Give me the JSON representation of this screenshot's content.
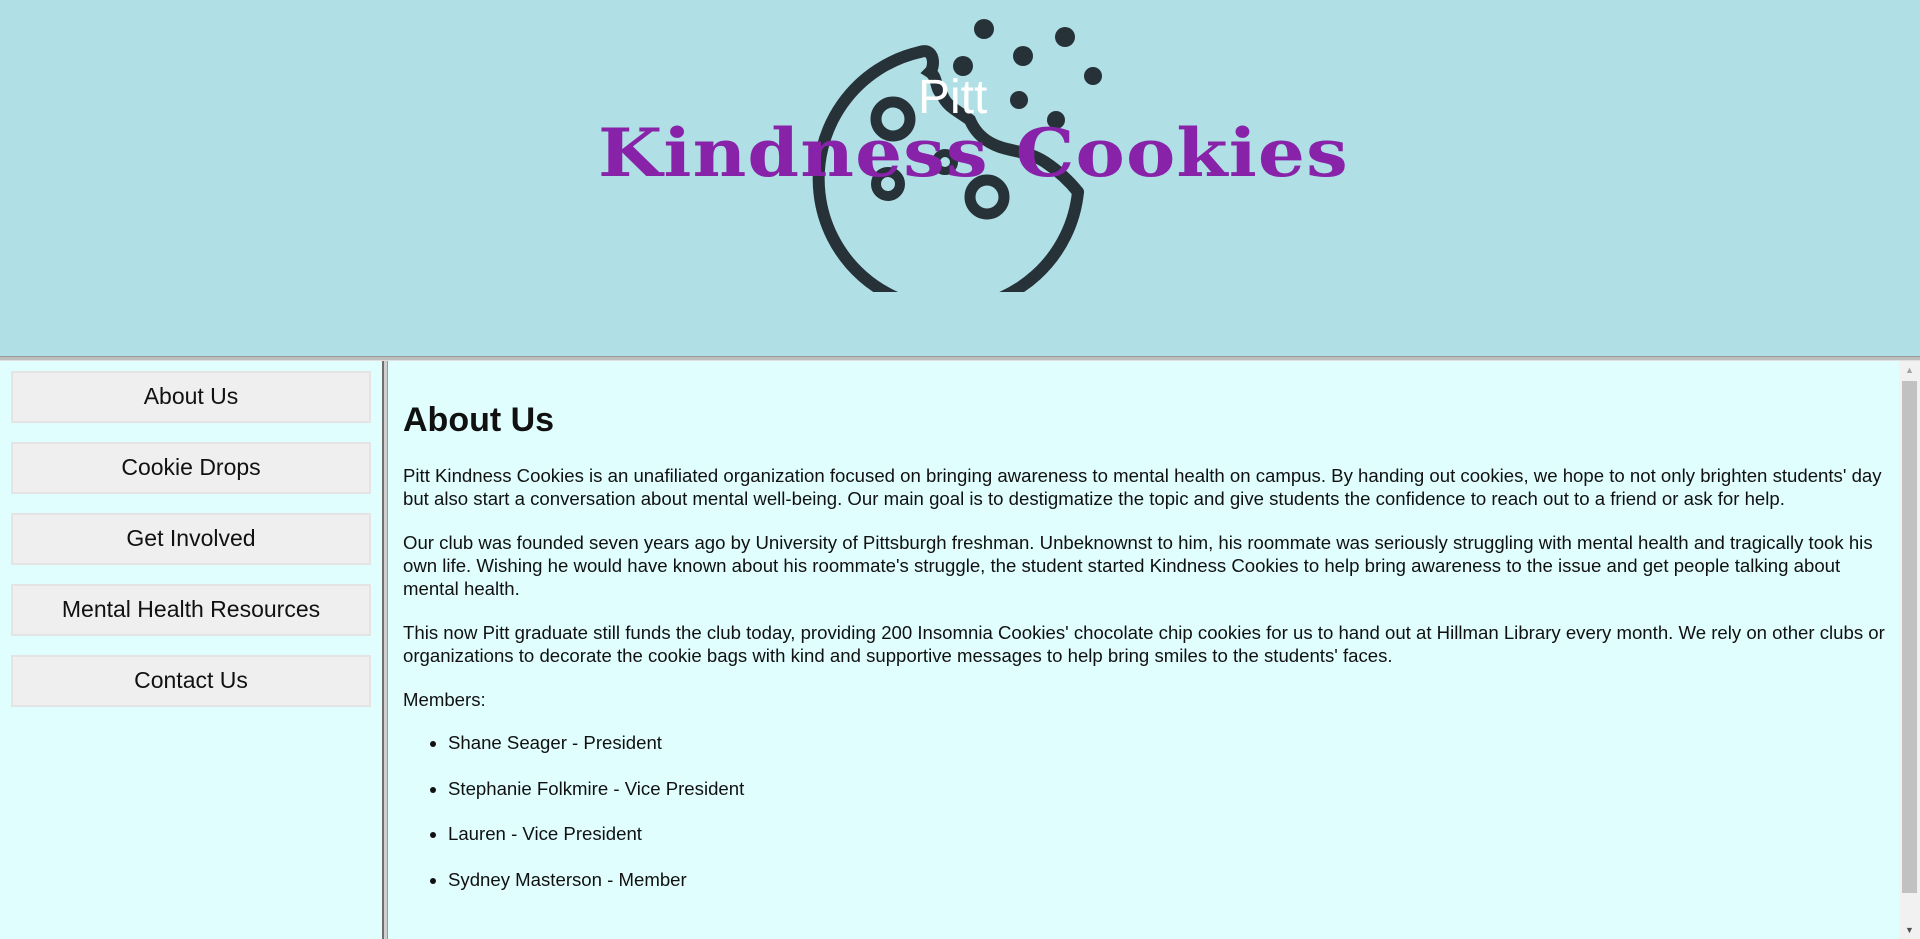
{
  "header": {
    "logo_small": "Pitt",
    "logo_main": "Kindness Cookies"
  },
  "colors": {
    "header_bg": "#b0dfe5",
    "content_bg": "#e0fefe",
    "brand_purple": "#8822a8",
    "cookie_dark": "#263238"
  },
  "sidebar": {
    "items": [
      {
        "label": "About Us"
      },
      {
        "label": "Cookie Drops"
      },
      {
        "label": "Get Involved"
      },
      {
        "label": "Mental Health Resources"
      },
      {
        "label": "Contact Us"
      }
    ]
  },
  "main": {
    "title": "About Us",
    "paragraphs": [
      "Pitt Kindness Cookies is an unafiliated organization focused on bringing awareness to mental health on campus. By handing out cookies, we hope to not only brighten students' day but also start a conversation about mental well-being. Our main goal is to destigmatize the topic and give students the confidence to reach out to a friend or ask for help.",
      "Our club was founded seven years ago by University of Pittsburgh freshman. Unbeknownst to him, his roommate was seriously struggling with mental health and tragically took his own life. Wishing he would have known about his roommate's struggle, the student started Kindness Cookies to help bring awareness to the issue and get people talking about mental health.",
      "This now Pitt graduate still funds the club today, providing 200 Insomnia Cookies' chocolate chip cookies for us to hand out at Hillman Library every month. We rely on other clubs or organizations to decorate the cookie bags with kind and supportive messages to help bring smiles to the students' faces."
    ],
    "members_label": "Members:",
    "members": [
      "Shane Seager - President",
      "Stephanie Folkmire - Vice President",
      "Lauren - Vice President",
      "Sydney Masterson - Member"
    ]
  },
  "icons": {
    "logo": "cookie-icon",
    "scroll_up": "arrow-up-icon",
    "scroll_down": "arrow-down-icon"
  }
}
